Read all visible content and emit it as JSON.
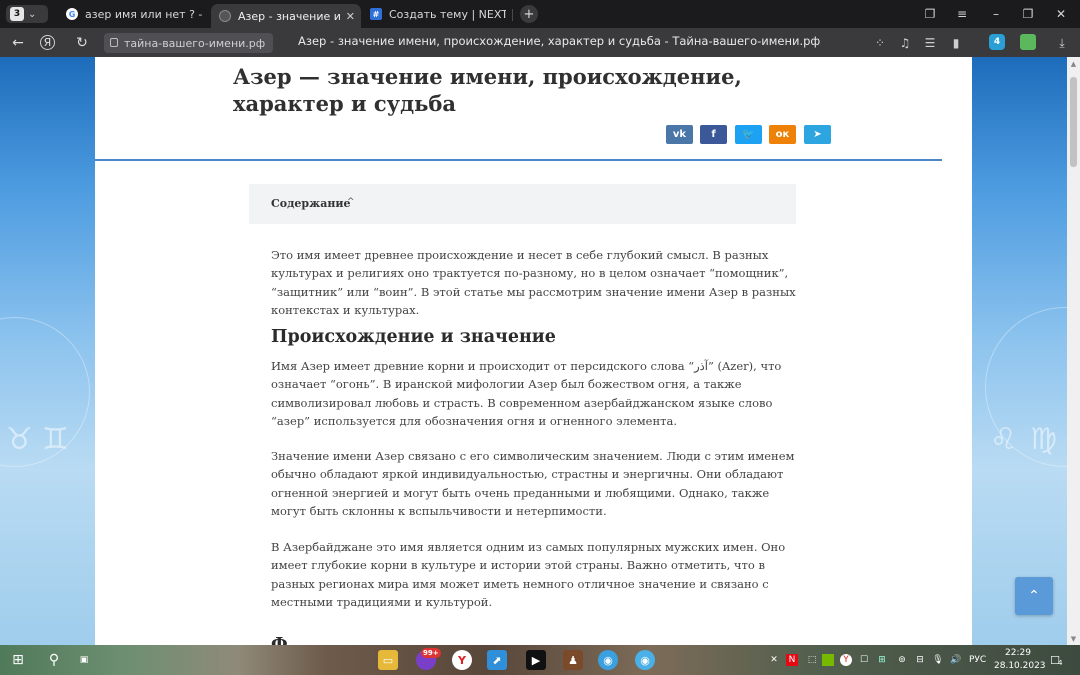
{
  "browser": {
    "tab_count": "3",
    "tabs": [
      {
        "label": "азер имя или нет ? - Поиск",
        "active": false
      },
      {
        "label": "Азер - значение имени",
        "active": true
      },
      {
        "label": "Создать тему | NEXTRP",
        "active": false
      }
    ],
    "url": "тайна-вашего-имени.рф",
    "page_title": "Азер - значение имени, происхождение, характер и судьба - Тайна-вашего-имени.рф"
  },
  "article": {
    "title": "Азер — значение имени, происхождение, характер и судьба",
    "share": [
      {
        "label": "vk",
        "color": "#4a76a8"
      },
      {
        "label": "f",
        "color": "#3b5998"
      },
      {
        "label": "t",
        "color": "#1da1f2"
      },
      {
        "label": "ok",
        "color": "#ee8208"
      },
      {
        "label": "tg",
        "color": "#2ca5e0"
      }
    ],
    "toc_label": "Содержание",
    "intro": "Это имя имеет древнее происхождение и несет в себе глубокий смысл. В разных культурах и религиях оно трактуется по-разному, но в целом означает “помощник”, “защитник” или “воин”. В этой статье мы рассмотрим значение имени Азер в разных контекстах и культурах.",
    "section1_heading": "Происхождение и значение",
    "section1_p1": "Имя Азер имеет древние корни и происходит от персидского слова “آذر” (Azer), что означает “огонь”. В иранской мифологии Азер был божеством огня, а также символизировал любовь и страсть. В современном азербайджанском языке слово “азер” используется для обозначения огня и огненного элемента.",
    "section1_p2": "Значение имени Азер связано с его символическим значением. Люди с этим именем обычно обладают яркой индивидуальностью, страстны и энергичны. Они обладают огненной энергией и могут быть очень преданными и любящими. Однако, также могут быть склонны к вспыльчивости и нетерпимости.",
    "section1_p3": "В Азербайджане это имя является одним из самых популярных мужских имен. Оно имеет глубокие корни в культуре и истории этой страны. Важно отметить, что в разных регионах мира имя может иметь немного отличное значение и связано с местными традициями и культурой.",
    "next_heading_partial": "Ф"
  },
  "taskbar": {
    "lang": "РУС",
    "time": "22:29",
    "date": "28.10.2023",
    "notif_count": "4",
    "badge_99": "99+"
  }
}
